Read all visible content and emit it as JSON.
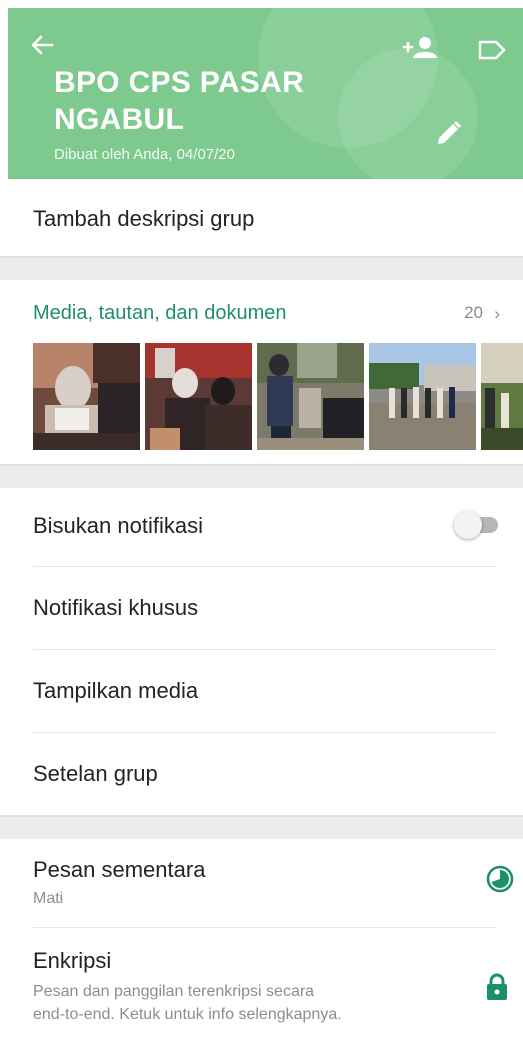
{
  "header": {
    "title": "BPO CPS PASAR NGABUL",
    "subtitle": "Dibuat oleh Anda, 04/07/20",
    "bg_color": "#7dc98e"
  },
  "description": {
    "placeholder": "Tambah deskripsi grup"
  },
  "media": {
    "title": "Media, tautan, dan dokumen",
    "count": "20",
    "chevron": "›",
    "accent": "#1d8f6c"
  },
  "settings": {
    "mute": {
      "label": "Bisukan notifikasi",
      "enabled": false
    },
    "custom": {
      "label": "Notifikasi khusus"
    },
    "media_vis": {
      "label": "Tampilkan media"
    },
    "group": {
      "label": "Setelan grup"
    }
  },
  "disappearing": {
    "label": "Pesan sementara",
    "value": "Mati"
  },
  "encryption": {
    "label": "Enkripsi",
    "line1": "Pesan dan panggilan terenkripsi secara",
    "line2": "end-to-end. Ketuk untuk info selengkapnya."
  },
  "icons": [
    "arrow-left-icon",
    "add-person-icon",
    "label-icon",
    "pencil-icon",
    "chevron-right-icon",
    "timer-icon",
    "lock-icon"
  ]
}
